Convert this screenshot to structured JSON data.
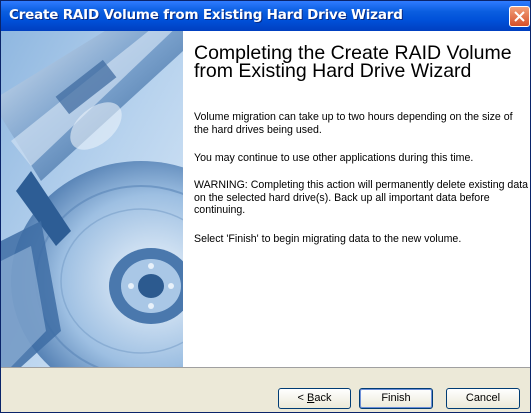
{
  "window": {
    "title": "Create RAID Volume from Existing Hard Drive Wizard",
    "accent_color": "#0054e3",
    "close_icon": "close-icon"
  },
  "content": {
    "heading": "Completing the Create RAID Volume from Existing Hard Drive Wizard",
    "paragraphs": [
      "Volume migration can take up to two hours depending on the size of the hard drives being used.",
      "You may continue to use other applications during this time.",
      "WARNING: Completing this action will permanently delete existing data on the selected hard drive(s). Back up all important data before continuing.",
      "Select 'Finish' to begin migrating data to the new volume."
    ]
  },
  "buttons": {
    "back_prefix": "< ",
    "back_accel": "B",
    "back_rest": "ack",
    "finish": "Finish",
    "cancel": "Cancel"
  }
}
